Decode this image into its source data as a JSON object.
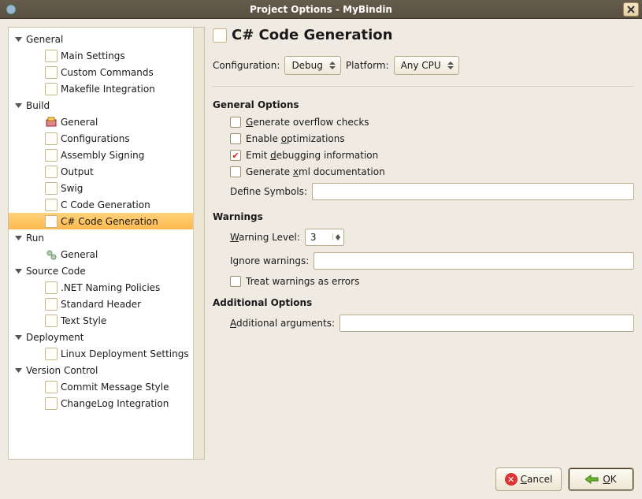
{
  "window": {
    "title": "Project Options - MyBindin"
  },
  "tree": {
    "general": {
      "label": "General",
      "main_settings": "Main Settings",
      "custom_commands": "Custom Commands",
      "makefile_integration": "Makefile Integration"
    },
    "build": {
      "label": "Build",
      "general": "General",
      "configurations": "Configurations",
      "assembly_signing": "Assembly Signing",
      "output": "Output",
      "swig": "Swig",
      "c_code_generation": "C Code Generation",
      "csharp_code_generation": "C# Code Generation"
    },
    "run": {
      "label": "Run",
      "general": "General"
    },
    "source_code": {
      "label": "Source Code",
      "net_naming": ".NET Naming Policies",
      "standard_header": "Standard Header",
      "text_style": "Text Style"
    },
    "deployment": {
      "label": "Deployment",
      "linux": "Linux Deployment Settings"
    },
    "version_control": {
      "label": "Version Control",
      "commit_msg": "Commit Message Style",
      "changelog": "ChangeLog Integration"
    }
  },
  "page": {
    "title": "C# Code Generation",
    "config_label": "Configuration:",
    "config_value": "Debug",
    "platform_label": "Platform:",
    "platform_value": "Any CPU",
    "sections": {
      "general": {
        "title": "General Options",
        "overflow": {
          "label_pre": "",
          "label_u": "G",
          "label_post": "enerate overflow checks",
          "checked": false
        },
        "optimize": {
          "label_pre": "Enable ",
          "label_u": "o",
          "label_post": "ptimizations",
          "checked": false
        },
        "debuginfo": {
          "label_pre": "Emit ",
          "label_u": "d",
          "label_post": "ebugging information",
          "checked": true
        },
        "xmldoc": {
          "label_pre": "Generate ",
          "label_u": "x",
          "label_post": "ml documentation",
          "checked": false
        },
        "define_label": "Define Symbols:",
        "define_value": ""
      },
      "warnings": {
        "title": "Warnings",
        "level_label_u": "W",
        "level_label_post": "arning Level:",
        "level_value": "3",
        "ignore_label": "Ignore warnings:",
        "ignore_value": "",
        "treat_as_errors": {
          "label": "Treat warnings as errors",
          "checked": false
        }
      },
      "additional": {
        "title": "Additional Options",
        "args_label_u": "A",
        "args_label_post": "dditional arguments:",
        "args_value": ""
      }
    }
  },
  "buttons": {
    "cancel_u": "C",
    "cancel_post": "ancel",
    "ok_u": "O",
    "ok_post": "K"
  }
}
